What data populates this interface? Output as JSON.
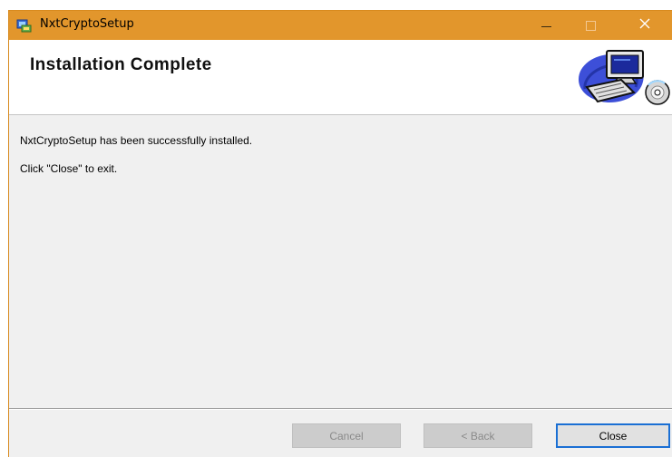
{
  "window": {
    "title": "NxtCryptoSetup",
    "title_bar_color": "#e2962c"
  },
  "header": {
    "title": "Installation Complete",
    "graphic_icon": "computer-setup-icon"
  },
  "content": {
    "message": "NxtCryptoSetup has been successfully installed.",
    "instruction": "Click \"Close\" to exit."
  },
  "buttons": {
    "cancel": {
      "label": "Cancel",
      "enabled": false
    },
    "back": {
      "label": "< Back",
      "enabled": false
    },
    "close": {
      "label": "Close",
      "enabled": true,
      "focused": true
    }
  },
  "icons": {
    "app": "installer-app-icon",
    "minimize": "minimize-icon",
    "maximize": "maximize-icon",
    "close": "close-icon"
  }
}
